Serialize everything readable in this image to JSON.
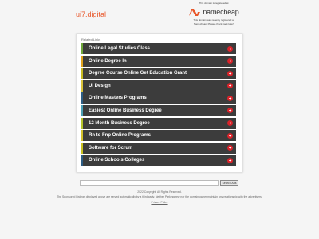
{
  "header": {
    "domain": "ui7.digital"
  },
  "namecheap": {
    "top_text": "This domain is registered at",
    "brand": "namecheap",
    "sub_text_1": "This domain was recently registered at",
    "sub_text_2": "Namecheap. Please check back later!",
    "brand_color": "#e8572a"
  },
  "related": {
    "heading": "Related Links",
    "items": [
      {
        "label": "Online Legal Studies Class",
        "stripe": "#6fa83a"
      },
      {
        "label": "Online Degree In",
        "stripe": "#e0a21b"
      },
      {
        "label": "Degree Course Online Get Education Grant",
        "stripe": "#c5b91f"
      },
      {
        "label": "Ui Design",
        "stripe": "#d9c23a"
      },
      {
        "label": "Online Masters Programs",
        "stripe": "#2d5d84"
      },
      {
        "label": "Easiest Online Business Degree",
        "stripe": "#4aa0b5"
      },
      {
        "label": "12 Month Business Degree",
        "stripe": "#b5c42a"
      },
      {
        "label": "Rn to Fnp Online Programs",
        "stripe": "#d2c02a"
      },
      {
        "label": "Software for Scrum",
        "stripe": "#c9c21f"
      },
      {
        "label": "Online Schools Colleges",
        "stripe": "#2d5d84"
      }
    ],
    "arrow_color": "#d9232a"
  },
  "search": {
    "placeholder": "",
    "button_label": "Search Ads"
  },
  "footer": {
    "copyright": "2022 Copyright. All Rights Reserved.",
    "disclaimer": "The Sponsored Listings displayed above are served automatically by a third party. Neither Parkingcrew nor the domain owner maintain any relationship with the advertisers.",
    "privacy_label": "Privacy Policy"
  }
}
